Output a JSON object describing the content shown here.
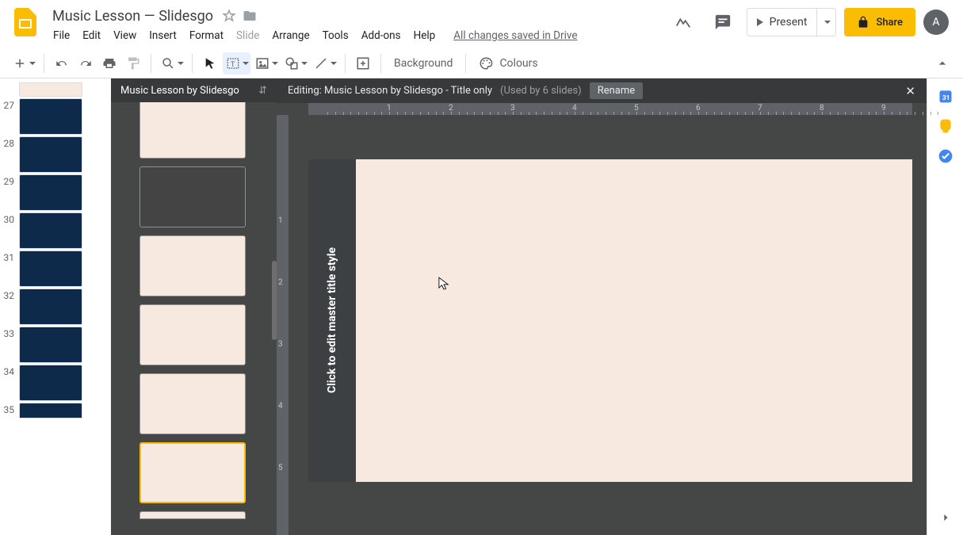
{
  "doc": {
    "title": "Music Lesson — Slidesgo"
  },
  "menus": {
    "file": "File",
    "edit": "Edit",
    "view": "View",
    "insert": "Insert",
    "format": "Format",
    "slide": "Slide",
    "arrange": "Arrange",
    "tools": "Tools",
    "addons": "Add-ons",
    "help": "Help"
  },
  "save_status": "All changes saved in Drive",
  "actions": {
    "present": "Present",
    "share": "Share"
  },
  "toolbar": {
    "background": "Background",
    "colours": "Colours"
  },
  "master": {
    "header": "Music Lesson by Slidesgo"
  },
  "editor": {
    "prefix": "Editing: ",
    "name": "Music Lesson by Slidesgo - Title only",
    "used": "(Used by 6 slides)",
    "rename": "Rename"
  },
  "slide": {
    "title_placeholder": "Click to edit master title style"
  },
  "filmstrip": {
    "start": 27,
    "count": 9
  },
  "ruler_inches": [
    1,
    2,
    3,
    4,
    5,
    6,
    7,
    8,
    9
  ],
  "ruler_v": [
    1,
    2,
    3,
    4,
    5
  ],
  "avatar_initial": "A"
}
